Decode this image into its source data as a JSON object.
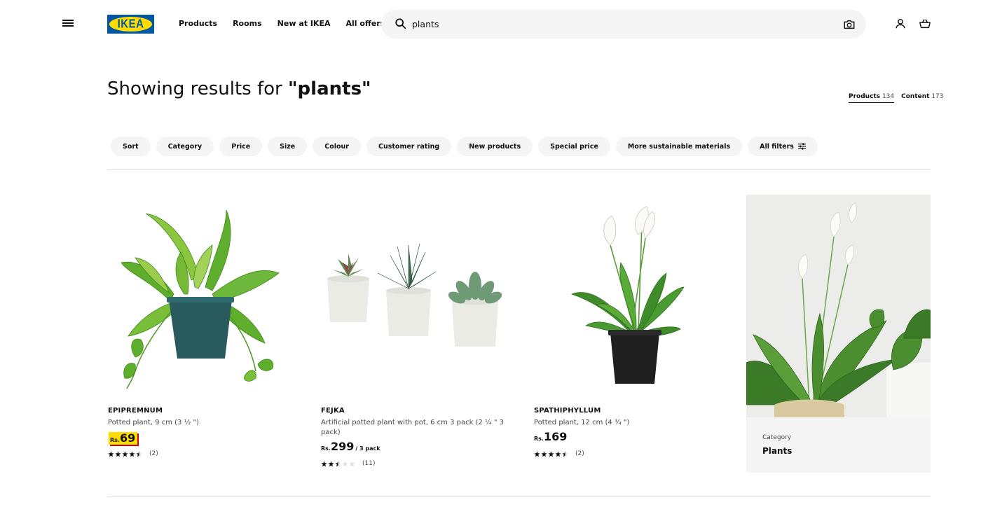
{
  "header": {
    "logo_text": "IKEA",
    "nav": [
      "Products",
      "Rooms",
      "New at IKEA",
      "All offers"
    ],
    "search_value": "plants"
  },
  "results": {
    "prefix": "Showing results for ",
    "query": "\"plants\"",
    "tabs": [
      {
        "label": "Products",
        "count": "134",
        "active": true
      },
      {
        "label": "Content",
        "count": "173",
        "active": false
      }
    ]
  },
  "filters": [
    "Sort",
    "Category",
    "Price",
    "Size",
    "Colour",
    "Customer rating",
    "New products",
    "Special price",
    "More sustainable materials",
    "All filters"
  ],
  "products": [
    {
      "name": "EPIPREMNUM",
      "description": "Potted plant, 9 cm (3 ½ \")",
      "currency": "Rs.",
      "price": "69",
      "unit": "",
      "highlight": true,
      "rating": 4.5,
      "reviews": "(2)"
    },
    {
      "name": "FEJKA",
      "description": "Artificial potted plant with pot, 6 cm 3 pack (2 ¼ \" 3 pack)",
      "currency": "Rs.",
      "price": "299",
      "unit": "/ 3 pack",
      "highlight": false,
      "rating": 2.5,
      "reviews": "(11)"
    },
    {
      "name": "SPATHIPHYLLUM",
      "description": "Potted plant, 12 cm (4 ¾ \")",
      "currency": "Rs.",
      "price": "169",
      "unit": "",
      "highlight": false,
      "rating": 4.5,
      "reviews": "(2)"
    }
  ],
  "category_card": {
    "label": "Category",
    "title": "Plants"
  },
  "colors": {
    "ikea_blue": "#0058a3",
    "ikea_yellow": "#ffdb00",
    "pill_bg": "#f5f5f5",
    "price_shadow": "#cc0008"
  }
}
